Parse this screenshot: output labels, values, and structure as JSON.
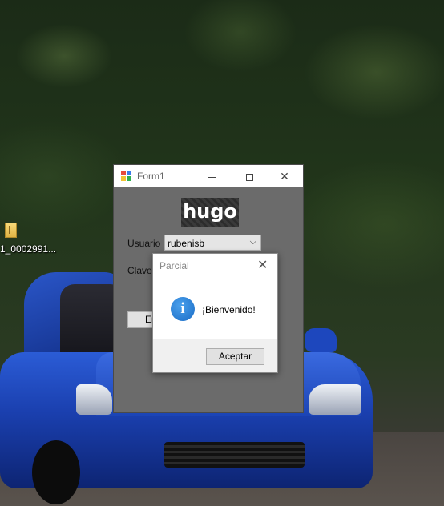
{
  "desktop": {
    "icons": [
      {
        "label": "1_0002991...",
        "icon": "file-zip-icon"
      }
    ]
  },
  "form1": {
    "title": "Form1",
    "logo_text": "hugo",
    "usuario_label": "Usuario",
    "usuario_value": "rubenisb",
    "clave_label": "Clave",
    "enter_button_label": "En"
  },
  "messagebox": {
    "title": "Parcial",
    "message": "¡Bienvenido!",
    "icon": "info-icon",
    "accept_button_label": "Aceptar"
  }
}
